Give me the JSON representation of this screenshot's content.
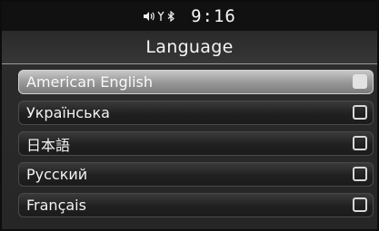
{
  "status": {
    "time": "9:16",
    "icons": [
      "volume-icon",
      "signal-icon",
      "bluetooth-icon"
    ]
  },
  "header": {
    "title": "Language"
  },
  "languages": [
    {
      "label": "American English",
      "selected": true
    },
    {
      "label": "Українська",
      "selected": false
    },
    {
      "label": "日本語",
      "selected": false
    },
    {
      "label": "Русский",
      "selected": false
    },
    {
      "label": "Français",
      "selected": false
    }
  ],
  "colors": {
    "selected_row": "#9a9a9a",
    "background": "#262626"
  }
}
